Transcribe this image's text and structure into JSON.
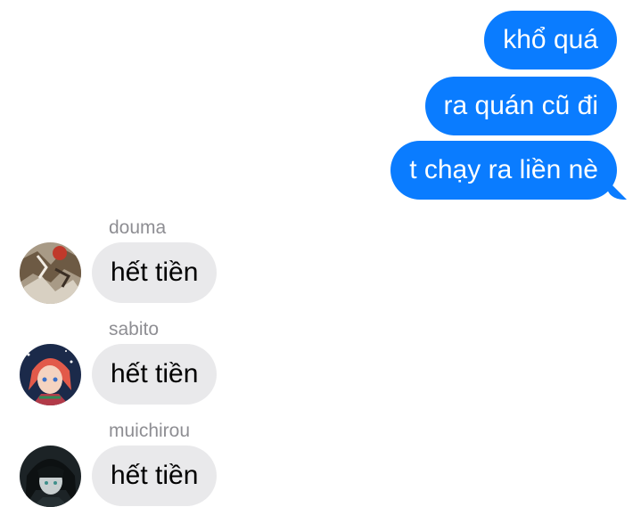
{
  "outgoing": [
    {
      "text": "khổ quá"
    },
    {
      "text": "ra quán cũ đi"
    },
    {
      "text": "t chạy ra liền nè"
    }
  ],
  "incoming": [
    {
      "sender": "douma",
      "text": "hết tiền",
      "avatar_icon": "douma-avatar"
    },
    {
      "sender": "sabito",
      "text": "hết tiền",
      "avatar_icon": "sabito-avatar"
    },
    {
      "sender": "muichirou",
      "text": "hết tiền",
      "avatar_icon": "muichirou-avatar"
    }
  ],
  "colors": {
    "outgoing_bubble": "#0a7cff",
    "incoming_bubble": "#e9e9eb",
    "sender_name": "#8e8e93"
  }
}
